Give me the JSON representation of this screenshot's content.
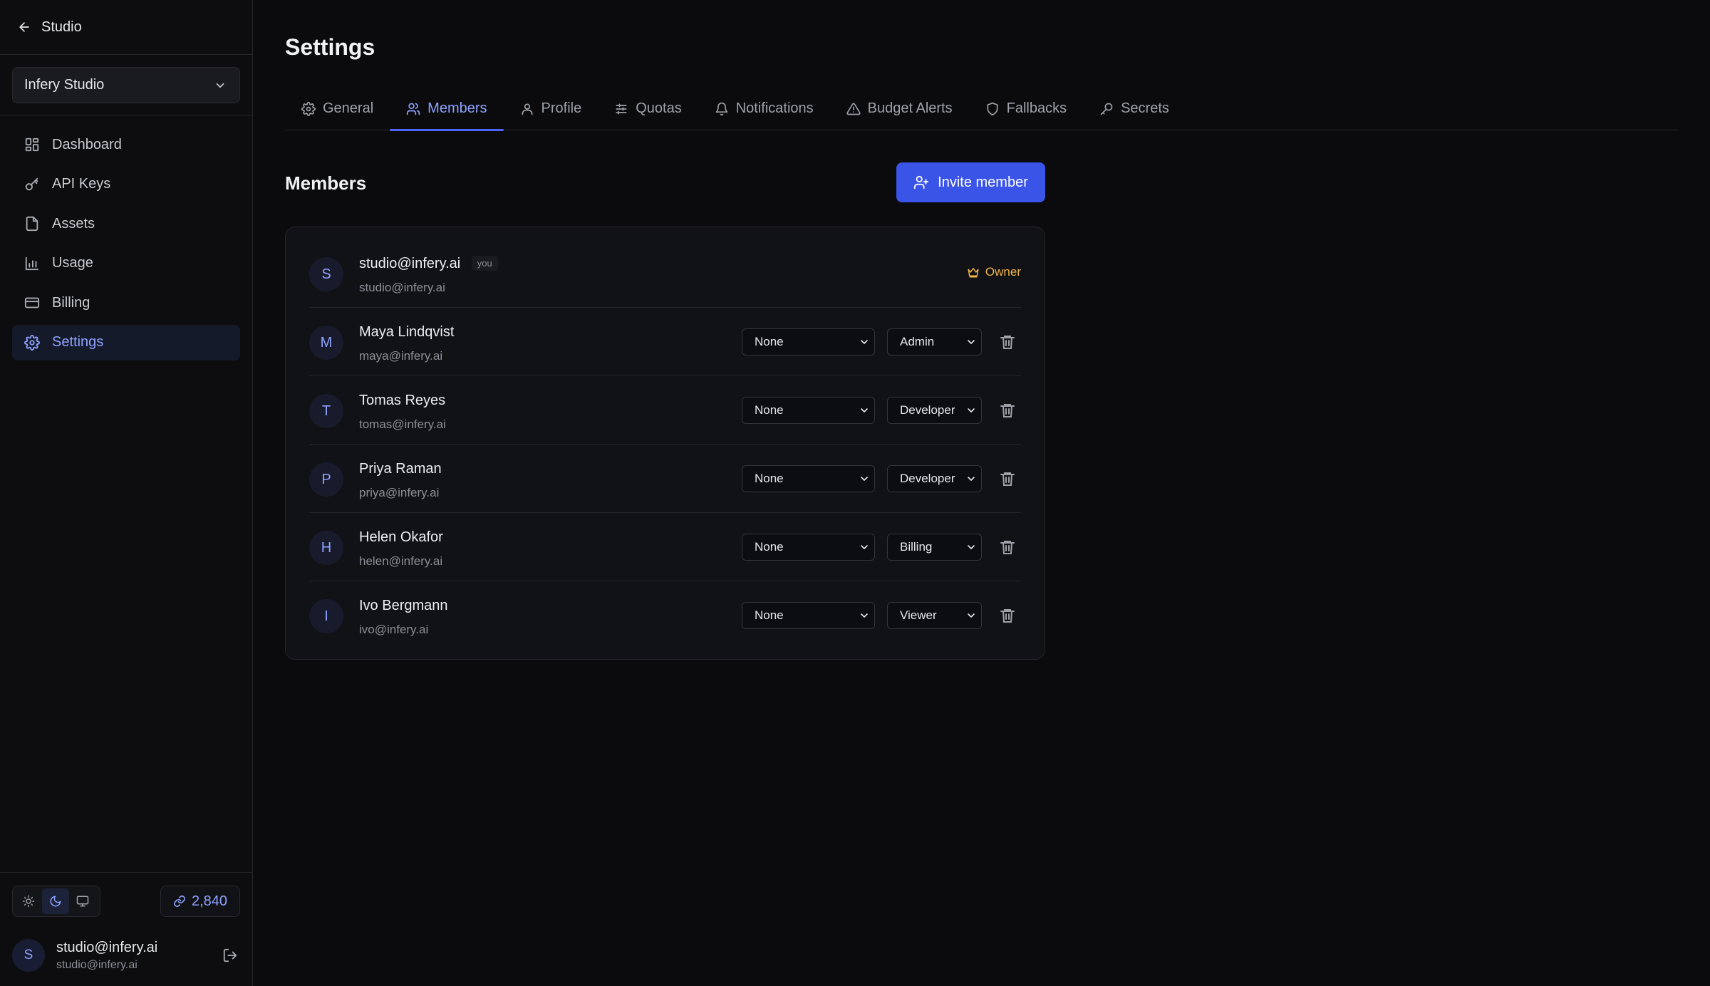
{
  "sidebar": {
    "back_label": "Studio",
    "org": {
      "name": "Infery Studio"
    },
    "items": [
      {
        "label": "Dashboard",
        "icon": "dashboard-icon"
      },
      {
        "label": "API Keys",
        "icon": "key-icon"
      },
      {
        "label": "Assets",
        "icon": "file-icon"
      },
      {
        "label": "Usage",
        "icon": "bar-chart-icon"
      },
      {
        "label": "Billing",
        "icon": "credit-card-icon"
      },
      {
        "label": "Settings",
        "icon": "gear-icon",
        "active": true
      }
    ],
    "theme": {
      "options": [
        "light",
        "dark",
        "system"
      ],
      "selected": "dark"
    },
    "credits": "2,840",
    "user": {
      "avatar": "S",
      "name": "studio@infery.ai",
      "email": "studio@infery.ai"
    }
  },
  "header": {
    "title": "Settings"
  },
  "tabs": [
    {
      "label": "General",
      "icon": "gear-icon"
    },
    {
      "label": "Members",
      "icon": "users-icon",
      "active": true
    },
    {
      "label": "Profile",
      "icon": "user-icon"
    },
    {
      "label": "Quotas",
      "icon": "sliders-icon"
    },
    {
      "label": "Notifications",
      "icon": "bell-icon"
    },
    {
      "label": "Budget Alerts",
      "icon": "alert-triangle-icon"
    },
    {
      "label": "Fallbacks",
      "icon": "shield-icon"
    },
    {
      "label": "Secrets",
      "icon": "key-icon"
    }
  ],
  "members_section": {
    "title": "Members",
    "invite_label": "Invite member",
    "owner": {
      "initial": "S",
      "name": "studio@infery.ai",
      "badge": "you",
      "email": "studio@infery.ai",
      "role": "Owner"
    },
    "members": [
      {
        "initial": "M",
        "name": "Maya Lindqvist",
        "email": "maya@infery.ai",
        "scope": "None",
        "role": "Admin"
      },
      {
        "initial": "T",
        "name": "Tomas Reyes",
        "email": "tomas@infery.ai",
        "scope": "None",
        "role": "Developer"
      },
      {
        "initial": "P",
        "name": "Priya Raman",
        "email": "priya@infery.ai",
        "scope": "None",
        "role": "Developer"
      },
      {
        "initial": "H",
        "name": "Helen Okafor",
        "email": "helen@infery.ai",
        "scope": "None",
        "role": "Billing"
      },
      {
        "initial": "I",
        "name": "Ivo Bergmann",
        "email": "ivo@infery.ai",
        "scope": "None",
        "role": "Viewer"
      }
    ]
  },
  "colors": {
    "accent": "#8ea2ff",
    "primary_button": "#3b54e8",
    "owner": "#f0b44a",
    "background": "#0b0b0e"
  }
}
